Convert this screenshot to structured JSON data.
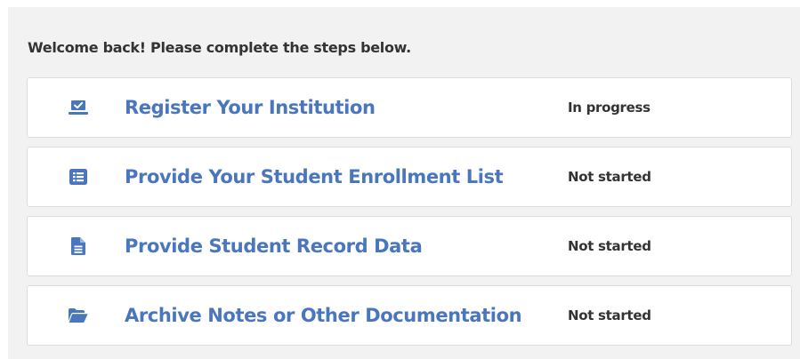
{
  "welcome_message": "Welcome back! Please complete the steps below.",
  "accent_color": "#4a76bd",
  "steps": [
    {
      "icon": "laptop-check-icon",
      "title": "Register Your Institution",
      "status": "In progress"
    },
    {
      "icon": "list-icon",
      "title": "Provide Your Student Enrollment List",
      "status": "Not started"
    },
    {
      "icon": "document-icon",
      "title": "Provide Student Record Data",
      "status": "Not started"
    },
    {
      "icon": "folder-open-icon",
      "title": "Archive Notes or Other Documentation",
      "status": "Not started"
    }
  ]
}
